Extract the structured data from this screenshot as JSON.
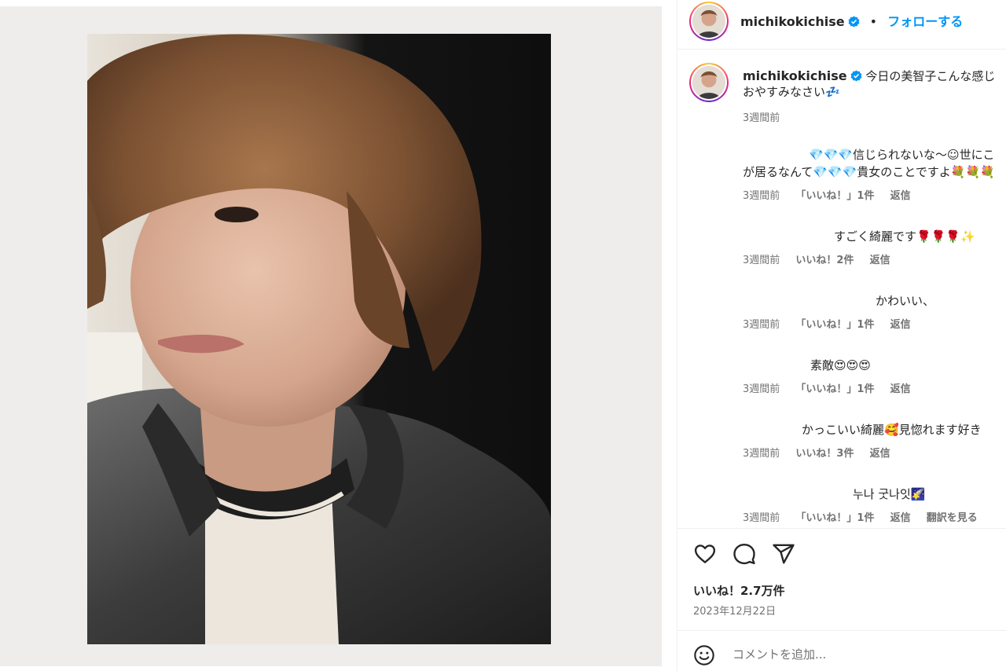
{
  "post": {
    "username": "michikokichise",
    "follow_label": "フォローする",
    "separator": "•",
    "caption_line1": "今日の美智子こんな感じ",
    "caption_line2": "おやすみなさい💤",
    "caption_time": "3週間前",
    "likes": "いいね！2.7万件",
    "date": "2023年12月22日",
    "comment_placeholder": "コメントを追加..."
  },
  "comments": [
    {
      "text": "💎💎💎信じられないな〜☺世にこ",
      "text2": "が居るなんて💎💎💎貴女のことですよ💐💐💐",
      "time": "3週間前",
      "likes": "「いいね！」1件",
      "reply": "返信"
    },
    {
      "text": "すごく綺麗です🌹🌹🌹✨",
      "time": "3週間前",
      "likes": "いいね！2件",
      "reply": "返信"
    },
    {
      "text": "かわいい、",
      "time": "3週間前",
      "likes": "「いいね！」1件",
      "reply": "返信"
    },
    {
      "text": "素敵😍😍😍",
      "time": "3週間前",
      "likes": "「いいね！」1件",
      "reply": "返信"
    },
    {
      "text": "かっこいい綺麗🥰見惚れます好き",
      "time": "3週間前",
      "likes": "いいね！3件",
      "reply": "返信"
    },
    {
      "text": "누나 굿나잇🌠",
      "time": "3週間前",
      "likes": "「いいね！」1件",
      "reply": "返信",
      "translate": "翻訳を見る"
    }
  ],
  "icons": {
    "like": "heart-icon",
    "comment": "comment-icon",
    "share": "share-icon",
    "emoji": "emoji-icon",
    "verified": "verified-badge-icon"
  },
  "colors": {
    "accent": "#0095f6",
    "muted": "#737373",
    "text": "#262626",
    "verified": "#0095f6"
  }
}
